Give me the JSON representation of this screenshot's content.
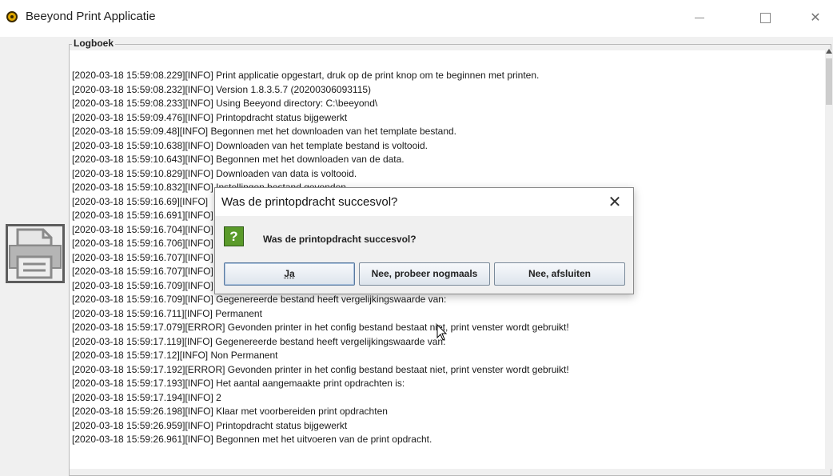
{
  "window": {
    "title": "Beeyond Print Applicatie",
    "app_icon": "beeyond-logo-icon",
    "controls": [
      "minimize",
      "maximize",
      "close"
    ]
  },
  "sidebar": {
    "print_button_icon": "printer-icon"
  },
  "logboek": {
    "title": "Logboek",
    "lines": [
      "[2020-03-18 15:59:08.229][INFO] Print applicatie opgestart, druk op de print knop om te beginnen met printen.",
      "[2020-03-18 15:59:08.232][INFO] Version 1.8.3.5.7 (20200306093115)",
      "[2020-03-18 15:59:08.233][INFO] Using Beeyond directory: C:\\beeyond\\",
      "[2020-03-18 15:59:09.476][INFO] Printopdracht status bijgewerkt",
      "[2020-03-18 15:59:09.48][INFO] Begonnen met het downloaden van het template bestand.",
      "[2020-03-18 15:59:10.638][INFO] Downloaden van het template bestand is voltooid.",
      "[2020-03-18 15:59:10.643][INFO] Begonnen met het downloaden van de data.",
      "[2020-03-18 15:59:10.829][INFO] Downloaden van data is voltooid.",
      "[2020-03-18 15:59:10.832][INFO] Instellingen bestand gevonden.",
      "[2020-03-18 15:59:16.69][INFO]",
      "[2020-03-18 15:59:16.691][INFO]",
      "[2020-03-18 15:59:16.704][INFO]",
      "[2020-03-18 15:59:16.706][INFO]",
      "[2020-03-18 15:59:16.707][INFO]",
      "[2020-03-18 15:59:16.707][INFO]",
      "[2020-03-18 15:59:16.709][INFO]",
      "[2020-03-18 15:59:16.709][INFO] Gegenereerde bestand heeft vergelijkingswaarde van:",
      "[2020-03-18 15:59:16.711][INFO] Permanent",
      "[2020-03-18 15:59:17.079][ERROR] Gevonden printer in het config bestand bestaat niet, print venster wordt gebruikt!",
      "[2020-03-18 15:59:17.119][INFO] Gegenereerde bestand heeft vergelijkingswaarde van:",
      "[2020-03-18 15:59:17.12][INFO] Non Permanent",
      "[2020-03-18 15:59:17.192][ERROR] Gevonden printer in het config bestand bestaat niet, print venster wordt gebruikt!",
      "[2020-03-18 15:59:17.193][INFO] Het aantal aangemaakte print opdrachten is:",
      "[2020-03-18 15:59:17.194][INFO] 2",
      "[2020-03-18 15:59:26.198][INFO] Klaar met voorbereiden print opdrachten",
      "[2020-03-18 15:59:26.959][INFO] Printopdracht status bijgewerkt",
      "[2020-03-18 15:59:26.961][INFO] Begonnen met het uitvoeren van de print opdracht."
    ]
  },
  "dialog": {
    "title": "Was de printopdracht succesvol?",
    "icon": "question-icon",
    "icon_glyph": "?",
    "message": "Was de printopdracht succesvol?",
    "buttons": {
      "yes": "Ja",
      "retry": "Nee, probeer nogmaals",
      "exit": "Nee, afsluiten"
    }
  },
  "colors": {
    "question_icon": "#5a9a2a",
    "window_bg": "#f0f0f0",
    "log_bg": "#ffffff"
  }
}
